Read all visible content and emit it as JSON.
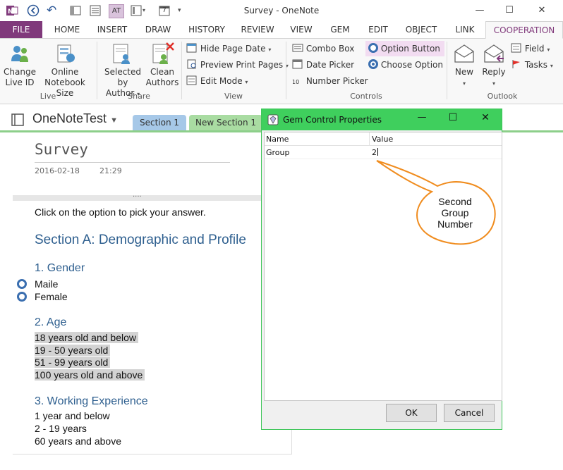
{
  "window": {
    "title": "Survey - OneNote",
    "minimize_glyph": "—",
    "maximize_glyph": "☐",
    "close_glyph": "✕"
  },
  "quick_access": {
    "undo_glyph": "↶",
    "customize_glyph": "▾",
    "calendar_day": "7"
  },
  "tabs": [
    {
      "label": "FILE"
    },
    {
      "label": "HOME"
    },
    {
      "label": "INSERT"
    },
    {
      "label": "DRAW"
    },
    {
      "label": "HISTORY"
    },
    {
      "label": "REVIEW"
    },
    {
      "label": "VIEW"
    },
    {
      "label": "GEM"
    },
    {
      "label": "EDIT"
    },
    {
      "label": "OBJECT"
    },
    {
      "label": "LINK"
    },
    {
      "label": "COOPERATION"
    }
  ],
  "ribbon": {
    "live": {
      "group_label": "Live",
      "change_live_id": "Change\nLive ID",
      "online_notebook_size": "Online\nNotebook Size"
    },
    "share": {
      "group_label": "Share",
      "selected_by_author_l1": "Selected by",
      "selected_by_author_l2": "Author",
      "clean_authors_l1": "Clean",
      "clean_authors_l2": "Authors"
    },
    "view": {
      "group_label": "View",
      "hide_page_date": "Hide Page Date",
      "preview_print_pages": "Preview Print Pages",
      "edit_mode": "Edit Mode"
    },
    "controls": {
      "group_label": "Controls",
      "combo_box": "Combo Box",
      "date_picker": "Date Picker",
      "number_picker": "Number Picker",
      "number_picker_icon_text": "10",
      "option_button": "Option Button",
      "choose_option": "Choose Option"
    },
    "outlook": {
      "group_label": "Outlook",
      "new": "New",
      "reply": "Reply",
      "field": "Field",
      "tasks": "Tasks"
    }
  },
  "notebook": {
    "name": "OneNoteTest",
    "sections": [
      {
        "label": "Section 1"
      },
      {
        "label": "New Section 1"
      }
    ]
  },
  "page": {
    "title": "Survey",
    "date": "2016-02-18",
    "time": "21:29",
    "handle": "....",
    "instruction": "Click on the option to pick your answer.",
    "section_heading": "Section A: Demographic and Profile",
    "q1_heading": "1. Gender",
    "q1_options": [
      "Maile",
      "Female"
    ],
    "q2_heading": "2. Age",
    "q2_options": [
      "18 years old and below",
      "19 - 50 years old",
      "51 - 99 years old",
      "100 years old and above"
    ],
    "q3_heading": "3. Working Experience",
    "q3_options": [
      "1 year and below",
      "2 - 19 years",
      "60 years and above"
    ]
  },
  "dialog": {
    "title": "Gem Control Properties",
    "col_name": "Name",
    "col_value": "Value",
    "row_name": "Group",
    "row_value": "2",
    "ok": "OK",
    "cancel": "Cancel"
  },
  "callout": {
    "line1": "Second",
    "line2": "Group",
    "line3": "Number"
  },
  "colors": {
    "accent_purple": "#80397b",
    "dialog_green": "#3fcf5d",
    "section1_tab": "#a6c8e8",
    "section2_tab": "#a9dca2",
    "callout_fill": "#ffffff",
    "callout_border": "#f08c1e",
    "heading_blue": "#2e5f8f"
  }
}
